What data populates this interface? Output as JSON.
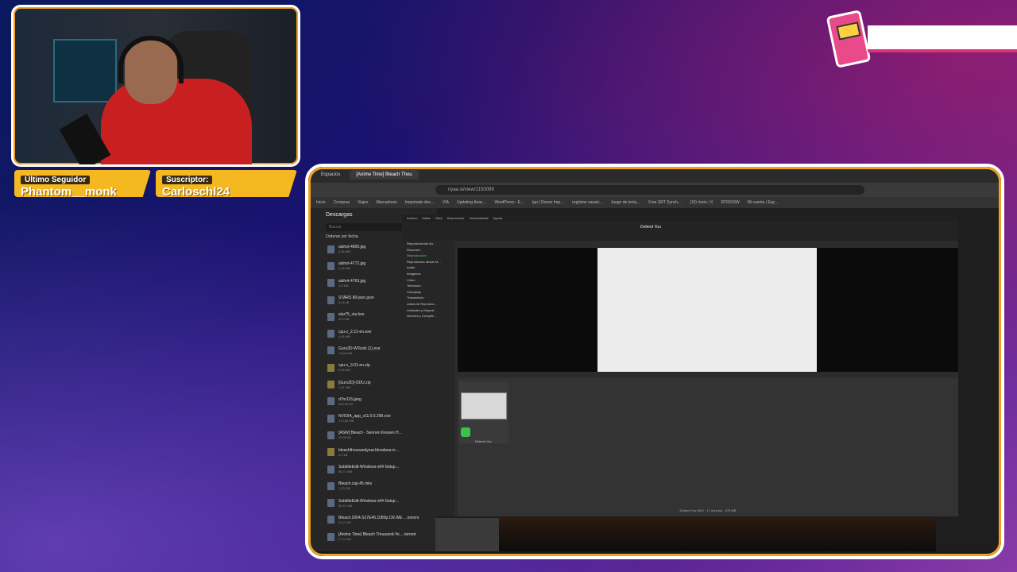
{
  "overlay": {
    "follower": {
      "label": "Último Seguidor",
      "name": "Phantom__monk"
    },
    "subscriber": {
      "label": "Suscriptor:",
      "name": "Carloschl24"
    }
  },
  "browser": {
    "tabs": [
      "Espacios",
      "[Anime Time] Bleach Thou"
    ],
    "url": "nyaa.si/view/2150099",
    "bookmarks": [
      "Inicio",
      "Compras",
      "Viajes",
      "Marcadores",
      "Importado des…",
      "VIA",
      "Updating Anac…",
      "WordPress › E…",
      "Igo | Donos Imp…",
      "regístrar usuari…",
      "Juego de tecla…",
      "Free SRT Synch…",
      "(15) Inicio / X",
      "RTR015W",
      "Mi cuenta | Esp…"
    ]
  },
  "downloads": {
    "title": "Descargas",
    "search_placeholder": "Buscar",
    "sort_label": "Ordenar por fecha",
    "items": [
      {
        "name": "alshot-4800.jpg",
        "size": "3,35 MB",
        "type": "file"
      },
      {
        "name": "alshot-4772.jpg",
        "size": "4,69 MB",
        "type": "file"
      },
      {
        "name": "alshot-4763.jpg",
        "size": "3,6 MB",
        "type": "file"
      },
      {
        "name": "STARS 80-json.json",
        "size": "8,46 kB",
        "type": "file"
      },
      {
        "name": "star75_via.hex",
        "size": "60,4 kB",
        "type": "file"
      },
      {
        "name": "cpu-z_2.21-en.exe",
        "size": "4,85 MB",
        "type": "file"
      },
      {
        "name": "Guru3D-WTools (1).exe",
        "size": "74,59 MB",
        "type": "file"
      },
      {
        "name": "cpu-z_3.01-en.zip",
        "size": "5,48 MB",
        "type": "folder"
      },
      {
        "name": "[Guru3D]-DDU.zip",
        "size": "1,21 MB",
        "type": "folder"
      },
      {
        "name": "d7nr115.jpeg",
        "size": "526,59 kB",
        "type": "file"
      },
      {
        "name": "NVIDIA_app_v11.0.6.299.exe",
        "size": "170,68 MB",
        "type": "file"
      },
      {
        "name": "[ASW] Bleach - Sennen Kessen H…",
        "size": "29,06 kB",
        "type": "file"
      },
      {
        "name": "bleachthousandyear.bloodwar.m…",
        "size": "8,2 kB",
        "type": "folder"
      },
      {
        "name": "SubtitleEdit-Windows-x64-Setup…",
        "size": "56,71 MB",
        "type": "file"
      },
      {
        "name": "Bleach.cap.45.mkv",
        "size": "1,23 GB",
        "type": "file"
      },
      {
        "name": "SubtitleEdit-Windows-x64-Setup…",
        "size": "55,47 MB",
        "type": "file"
      },
      {
        "name": "Bleach.2004.S17E45.1080p.CR.WE….torrent",
        "size": "21,72 kB",
        "type": "file"
      },
      {
        "name": "[Anime Time] Bleach Thousand-Ye….torrent",
        "size": "27,72 kB",
        "type": "file"
      }
    ]
  },
  "player": {
    "menu": [
      "Archivo",
      "Editar",
      "Vista",
      "Reproductor",
      "Herramientas",
      "Ayuda"
    ],
    "title": "Defend You",
    "sidebar": [
      "Reproduciendo Ah…",
      "Resumen",
      "Reproducción",
      "Reproducido desde M…",
      "Audio",
      "Imágenes",
      "Vídeo",
      "Televisión",
      "Cloudplay",
      "Transmisión",
      "Listas de Reproduc…",
      "Unidades y Disposi…",
      "Servidor y Compile…"
    ],
    "selected_index": 2,
    "view_label": "Reproductor",
    "thumb_caption": "Defend You",
    "status": "Defend You.MKV · 17 minutos · 475 MB"
  }
}
